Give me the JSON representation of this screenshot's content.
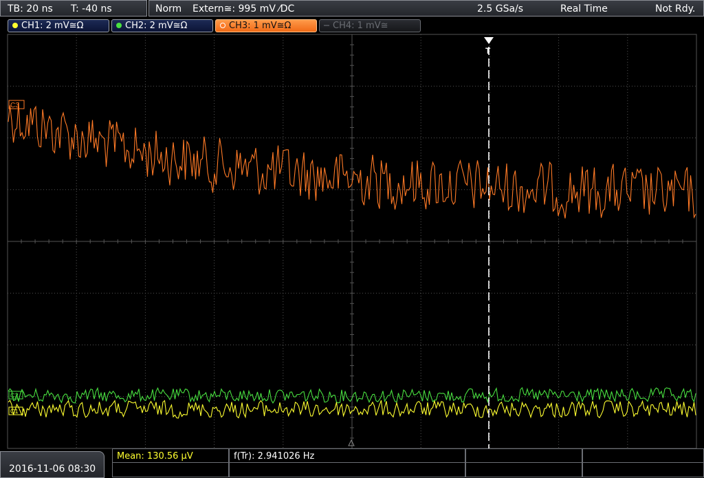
{
  "status_bar": {
    "timebase": "TB: 20 ns",
    "trigger_time": "T: -40 ns",
    "mode": "Norm",
    "trigger_source": "Extern≅: 995 mV ⁄DC",
    "sample_rate": "2.5 GSa/s",
    "acquisition": "Real Time",
    "state": "Not Rdy."
  },
  "channels": [
    {
      "label": "CH1: 2 mV≅Ω",
      "color": "#ffff30",
      "active": false
    },
    {
      "label": "CH2: 2 mV≅Ω",
      "color": "#49e040",
      "active": false
    },
    {
      "label": "CH3: 1 mV≅Ω",
      "color": "#ff8a33",
      "active": true
    },
    {
      "label": "CH4: 1 mV≅",
      "color": "#6a6d73",
      "active": false
    }
  ],
  "markers": {
    "ch3": "C3",
    "ch2": "C2",
    "ch1": "C1",
    "trigger": "T"
  },
  "footer": {
    "datetime": "2016-11-06 08:30",
    "mean": "Mean: 130.56 µV",
    "frequency": "f(Tr): 2.941026 Hz"
  },
  "colors": {
    "ch1": "#ffff30",
    "ch2": "#49e040",
    "ch3": "#ff7a26",
    "grid": "#5a5a5a",
    "accent_orange": "#ff7a26"
  }
}
